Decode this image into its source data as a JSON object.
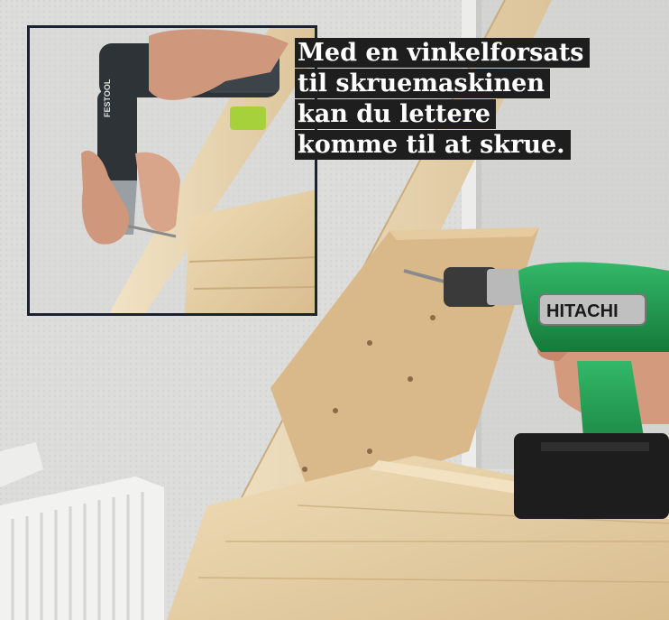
{
  "caption": {
    "lines": [
      "Med en vinkelforsats",
      "til skruemaskinen",
      "kan du lettere",
      "komme til at skrue."
    ]
  },
  "photo": {
    "drill_brand_text": "HITACHI",
    "inset_drill_brand_text": "FESTOOL"
  },
  "colors": {
    "wall": "#dcdcda",
    "wood": "#e6cfa6",
    "drill_green": "#1f9e4f",
    "inset_border": "#1b2233",
    "caption_bg": "#1e1e1e"
  }
}
